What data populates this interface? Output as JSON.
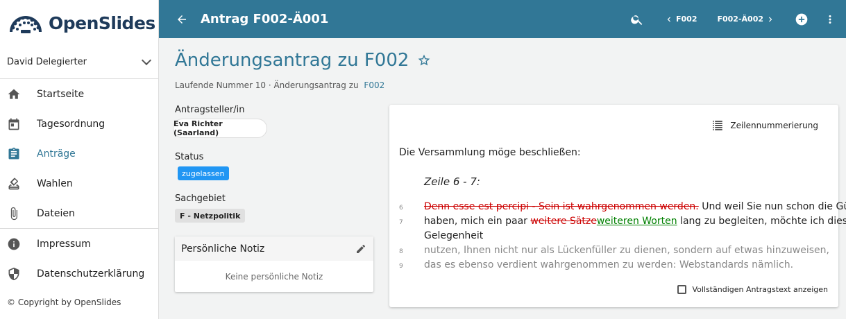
{
  "app": {
    "name": "OpenSlides"
  },
  "user": {
    "name": "David Delegierter"
  },
  "nav": [
    {
      "label": "Startseite",
      "icon": "home-icon"
    },
    {
      "label": "Tagesordnung",
      "icon": "calendar-icon"
    },
    {
      "label": "Anträge",
      "icon": "clipboard-icon",
      "active": true
    },
    {
      "label": "Wahlen",
      "icon": "ballot-icon"
    },
    {
      "label": "Dateien",
      "icon": "paperclip-icon"
    },
    {
      "label": "Impressum",
      "icon": "info-icon"
    },
    {
      "label": "Datenschutzerklärung",
      "icon": "shield-icon"
    }
  ],
  "footer": {
    "copyright": "© Copyright by OpenSlides"
  },
  "topbar": {
    "title": "Antrag F002-Ä001",
    "prev_label": "F002",
    "next_label": "F002-Ä002"
  },
  "page": {
    "title": "Änderungsantrag zu F002",
    "subline_prefix": "Laufende Nummer 10 · Änderungsantrag zu",
    "subline_link": "F002"
  },
  "meta": {
    "submitter_label": "Antragsteller/in",
    "submitter": "Eva Richter (Saarland)",
    "status_label": "Status",
    "status": "zugelassen",
    "category_label": "Sachgebiet",
    "category": "F - Netzpolitik"
  },
  "note": {
    "title": "Persönliche Notiz",
    "empty": "Keine persönliche Notiz"
  },
  "motion": {
    "line_numbering_label": "Zeilennummerierung",
    "intro": "Die Versammlung möge beschließen:",
    "range_label": "Zeile 6 - 7:",
    "lines": [
      {
        "num": "6",
        "del": "Denn esse est percipi - Sein ist wahrgenommen werden.",
        "rest": " Und weil Sie nun schon die Güte"
      },
      {
        "num": "7",
        "pre": "haben, mich ein paar ",
        "del": "weitere Sätze",
        "ins": "weiteren Worten",
        "post": " lang zu begleiten, möchte ich diese"
      },
      {
        "num": "",
        "text": "Gelegenheit"
      },
      {
        "num": "8",
        "text": "nutzen, Ihnen nicht nur als Lückenfüller zu dienen, sondern auf etwas hinzuweisen,"
      },
      {
        "num": "9",
        "text": "das es ebenso verdient wahrgenommen zu werden: Webstandards nämlich."
      }
    ],
    "show_full_label": "Vollständigen Antragstext anzeigen"
  },
  "colors": {
    "primary": "#317796",
    "deleted": "#cc0000",
    "inserted": "#008000",
    "status": "#2196f3"
  }
}
